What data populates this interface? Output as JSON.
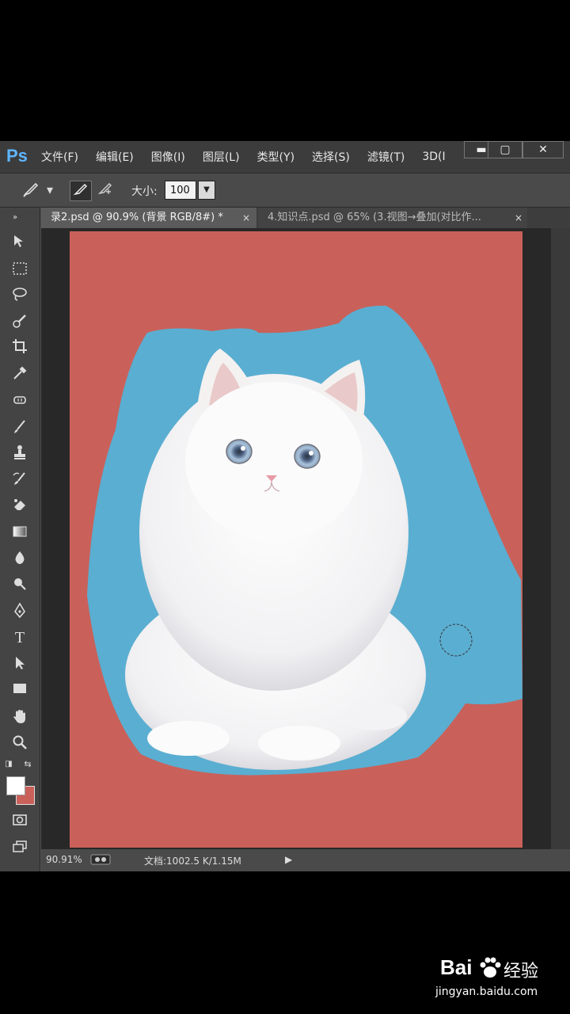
{
  "menubar": {
    "logo": "Ps",
    "items": [
      "文件(F)",
      "编辑(E)",
      "图像(I)",
      "图层(L)",
      "类型(Y)",
      "选择(S)",
      "滤镜(T)",
      "3D(I"
    ],
    "minimize": "▬",
    "maximize": "▢",
    "close": "✕"
  },
  "options": {
    "size_label": "大小:",
    "size_value": "100"
  },
  "tabs": [
    {
      "label": "录2.psd @ 90.9% (背景 RGB/8#) *",
      "close": "×"
    },
    {
      "label": "4.知识点.psd @ 65% (3.视图→叠加(对比作...",
      "close": "×"
    }
  ],
  "status": {
    "zoom": "90.91%",
    "doc": "文档:1002.5 K/1.15M",
    "arrow": "▶"
  },
  "watermark": {
    "brand": "Bai",
    "brand2": "经验",
    "url": "jingyan.baidu.com"
  },
  "colors": {
    "canvas_bg": "#c9615a",
    "mask_blue": "#5aaed1",
    "foreground": "#ffffff",
    "background": "#c9615a"
  }
}
